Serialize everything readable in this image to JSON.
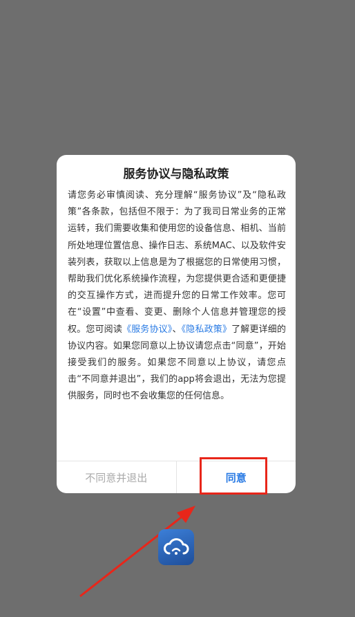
{
  "dialog": {
    "title": "服务协议与隐私政策",
    "body_part1": "请您务必审慎阅读、充分理解“服务协议”及“隐私政策”各条款，包括但不限于：为了我司日常业务的正常运转，我们需要收集和使用您的设备信息、相机、当前所处地理位置信息、操作日志、系统MAC、以及软件安装列表，获取以上信息是为了根据您的日常使用习惯，帮助我们优化系统操作流程，为您提供更合适和更便捷的交互操作方式，进而提升您的日常工作效率。您可在“设置”中查看、变更、删除个人信息并管理您的授权。您可阅读",
    "link_service": "《服务协议》",
    "separator": "、",
    "link_privacy": "《隐私政策》",
    "body_part2": "了解更详细的协议内容。如果您同意以上协议请您点击“同意”，开始接受我们的服务。如果您不同意以上协议，请您点击“不同意并退出”，我们的app将会退出，无法为您提供服务，同时也不会收集您的任何信息。",
    "disagree_label": "不同意并退出",
    "agree_label": "同意"
  },
  "colors": {
    "accent": "#2a7be4",
    "annotation": "#e8261a",
    "overlay": "#6e6e6e"
  },
  "icons": {
    "app_icon": "cloud-app-icon"
  }
}
